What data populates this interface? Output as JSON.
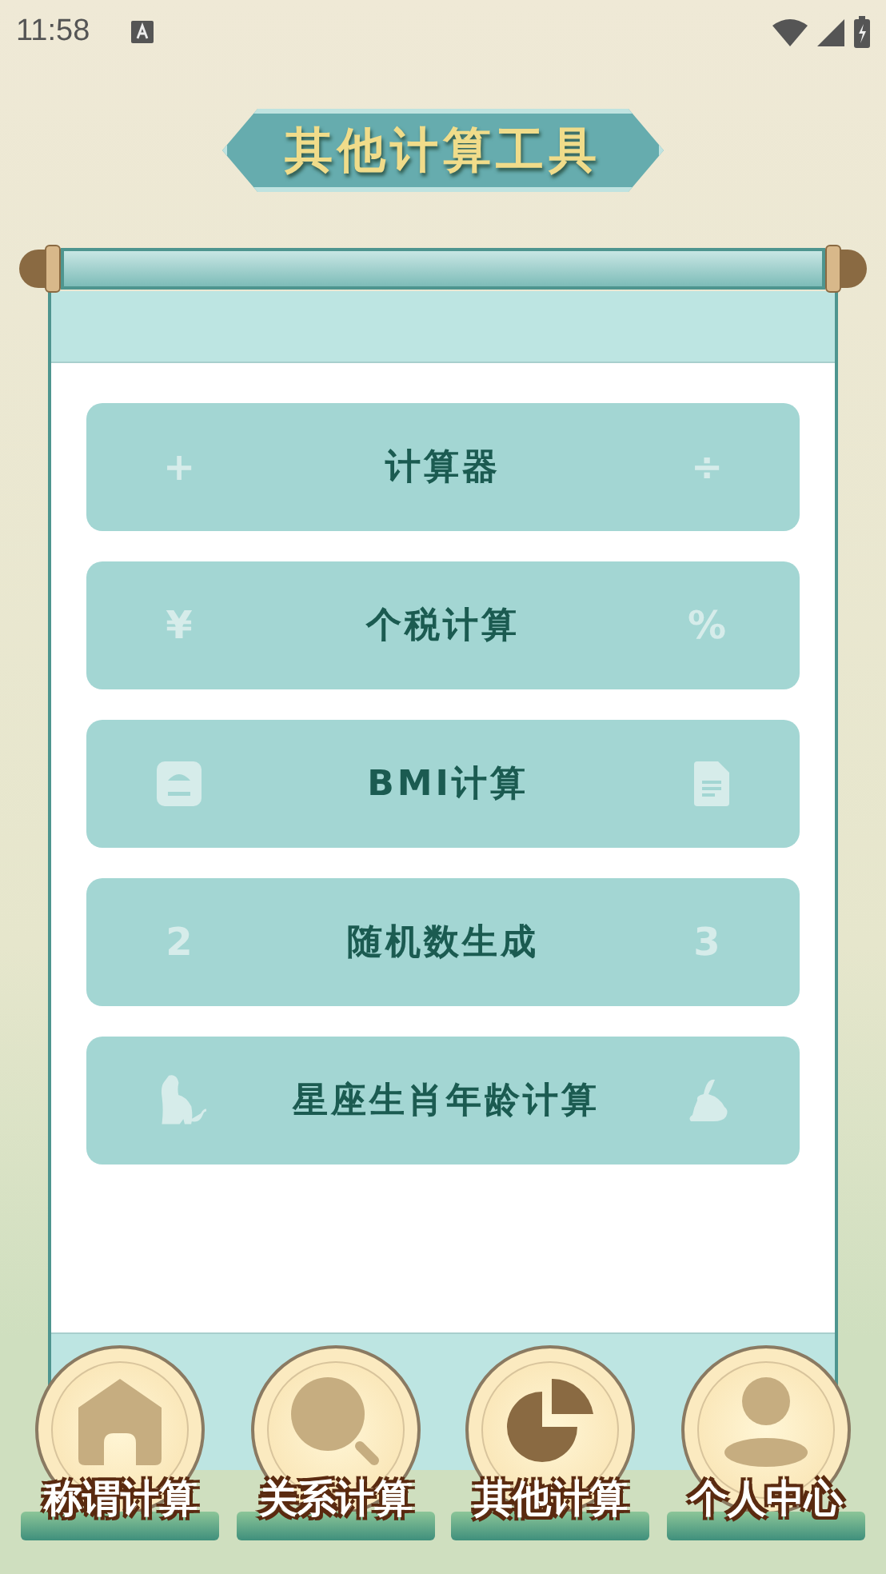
{
  "status_bar": {
    "time": "11:58"
  },
  "header": {
    "title": "其他计算工具"
  },
  "menu": [
    {
      "label": "计算器",
      "left": {
        "kind": "glyph",
        "text": "+"
      },
      "right": {
        "kind": "glyph",
        "text": "÷"
      }
    },
    {
      "label": "个税计算",
      "left": {
        "kind": "glyph",
        "text": "¥"
      },
      "right": {
        "kind": "glyph",
        "text": "%"
      }
    },
    {
      "label": "BMI计算",
      "left": {
        "kind": "scale"
      },
      "right": {
        "kind": "document"
      }
    },
    {
      "label": "随机数生成",
      "left": {
        "kind": "glyph",
        "text": "2"
      },
      "right": {
        "kind": "glyph",
        "text": "3"
      }
    },
    {
      "label": "星座生肖年龄计算",
      "left": {
        "kind": "cat"
      },
      "right": {
        "kind": "rabbit"
      }
    }
  ],
  "nav": [
    {
      "label": "称谓计算",
      "kind": "house",
      "selected": false
    },
    {
      "label": "关系计算",
      "kind": "search",
      "selected": false
    },
    {
      "label": "其他计算",
      "kind": "pie",
      "selected": true
    },
    {
      "label": "个人中心",
      "kind": "person",
      "selected": false
    }
  ]
}
